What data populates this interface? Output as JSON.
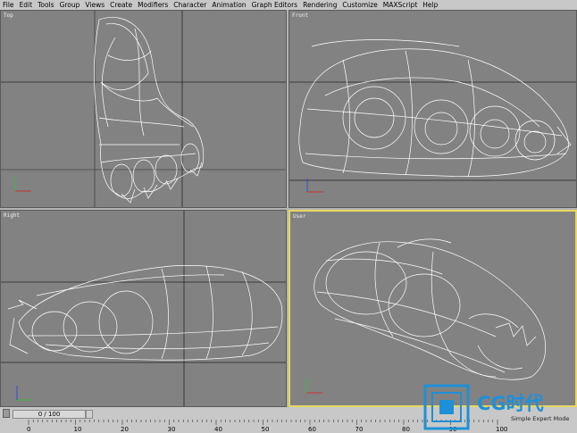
{
  "menu": [
    "File",
    "Edit",
    "Tools",
    "Group",
    "Views",
    "Create",
    "Modifiers",
    "Character",
    "Animation",
    "Graph Editors",
    "Rendering",
    "Customize",
    "MAXScript",
    "Help"
  ],
  "viewports": {
    "top": {
      "label": "Top"
    },
    "front": {
      "label": "Front"
    },
    "right": {
      "label": "Right"
    },
    "user": {
      "label": "User"
    }
  },
  "timeslider": {
    "label": "0 / 100"
  },
  "ruler": {
    "ticks": [
      "0",
      "10",
      "20",
      "30",
      "40",
      "50",
      "60",
      "70",
      "80",
      "90",
      "100"
    ]
  },
  "brand": {
    "text": "CG时代"
  },
  "status": {
    "text": "Simple Expert Mode"
  },
  "colors": {
    "active_border": "#e8d860",
    "wire": "#ffffff",
    "viewport_bg": "#828282",
    "logo_blue": "#1e90d8"
  }
}
